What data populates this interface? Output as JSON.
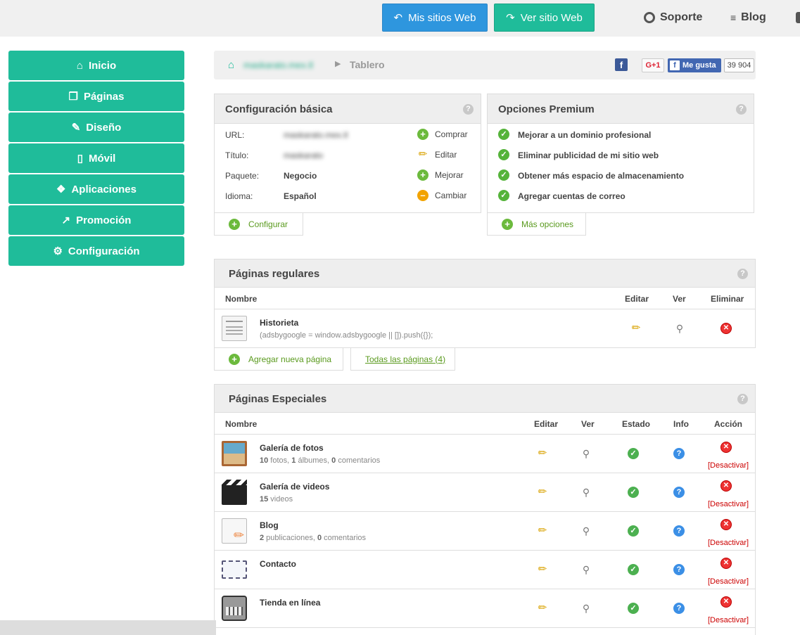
{
  "top": {
    "my_sites": "Mis sitios Web",
    "view_site": "Ver sitio Web",
    "support": "Soporte",
    "blog": "Blog"
  },
  "sidebar": {
    "items": [
      {
        "label": "Inicio",
        "icon": "home-icon"
      },
      {
        "label": "Páginas",
        "icon": "pages-icon"
      },
      {
        "label": "Diseño",
        "icon": "brush-icon"
      },
      {
        "label": "Móvil",
        "icon": "mobile-icon"
      },
      {
        "label": "Aplicaciones",
        "icon": "apps-icon"
      },
      {
        "label": "Promoción",
        "icon": "chart-icon"
      },
      {
        "label": "Configuración",
        "icon": "gears-icon"
      }
    ]
  },
  "breadcrumb": {
    "site": "maskarato.mex.tl",
    "current": "Tablero",
    "gplus": "G+1",
    "like": "Me gusta",
    "like_count": "39 904"
  },
  "basic": {
    "title": "Configuración básica",
    "rows": [
      {
        "label": "URL:",
        "value": "maskarato.mex.tl",
        "action": "Comprar"
      },
      {
        "label": "Título:",
        "value": "maskarato",
        "action": "Editar"
      },
      {
        "label": "Paquete:",
        "value": "Negocio",
        "action": "Mejorar"
      },
      {
        "label": "Idioma:",
        "value": "Español",
        "action": "Cambiar"
      }
    ],
    "configure": "Configurar"
  },
  "premium": {
    "title": "Opciones Premium",
    "items": [
      "Mejorar a un dominio profesional",
      "Eliminar publicidad de mi sitio web",
      "Obtener más espacio de almacenamiento",
      "Agregar cuentas de correo"
    ],
    "more": "Más opciones"
  },
  "regular": {
    "title": "Páginas regulares",
    "headers": {
      "name": "Nombre",
      "edit": "Editar",
      "view": "Ver",
      "delete": "Eliminar"
    },
    "rows": [
      {
        "name": "Historieta",
        "sub": "(adsbygoogle = window.adsbygoogle || []).push({});"
      }
    ],
    "add": "Agregar nueva página",
    "all": "Todas las páginas (4)"
  },
  "special": {
    "title": "Páginas Especiales",
    "headers": {
      "name": "Nombre",
      "edit": "Editar",
      "view": "Ver",
      "state": "Estado",
      "info": "Info",
      "action": "Acción"
    },
    "deactivate": "[Desactivar]",
    "rows": [
      {
        "name": "Galería de fotos",
        "n1": "10",
        "t1": " fotos, ",
        "n2": "1",
        "t2": " álbumes, ",
        "n3": "0",
        "t3": " comentarios"
      },
      {
        "name": "Galería de videos",
        "n1": "15",
        "t1": " videos",
        "n2": "",
        "t2": "",
        "n3": "",
        "t3": ""
      },
      {
        "name": "Blog",
        "n1": "2",
        "t1": " publicaciones, ",
        "n2": "0",
        "t2": " comentarios",
        "n3": "",
        "t3": ""
      },
      {
        "name": "Contacto",
        "n1": "",
        "t1": "",
        "n2": "",
        "t2": "",
        "n3": "",
        "t3": ""
      },
      {
        "name": "Tienda en línea",
        "n1": "",
        "t1": "",
        "n2": "",
        "t2": "",
        "n3": "",
        "t3": ""
      }
    ]
  }
}
